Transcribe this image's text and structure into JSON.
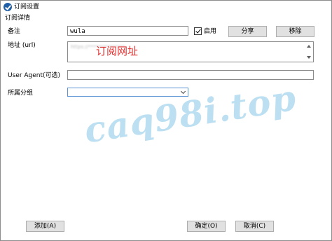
{
  "window": {
    "title": "订阅设置"
  },
  "section": {
    "label": "订阅详情"
  },
  "form": {
    "remark_label": "备注",
    "remark_value": "wula",
    "enable_label": "启用",
    "share_button": "分享",
    "remove_button": "移除",
    "url_label": "地址 (url)",
    "url_value_obscured": "https://***************",
    "url_overlay": "订阅网址",
    "user_agent_label": "User Agent(可选)",
    "user_agent_value": "",
    "group_label": "所属分组",
    "group_value": ""
  },
  "footer": {
    "add_button": "添加(A)",
    "ok_button": "确定(O)",
    "cancel_button": "取消(C)"
  },
  "watermark": "caq98i.top",
  "colors": {
    "accent": "#5a93d6",
    "overlay_red": "#e23030",
    "watermark": "#bcdff2"
  }
}
